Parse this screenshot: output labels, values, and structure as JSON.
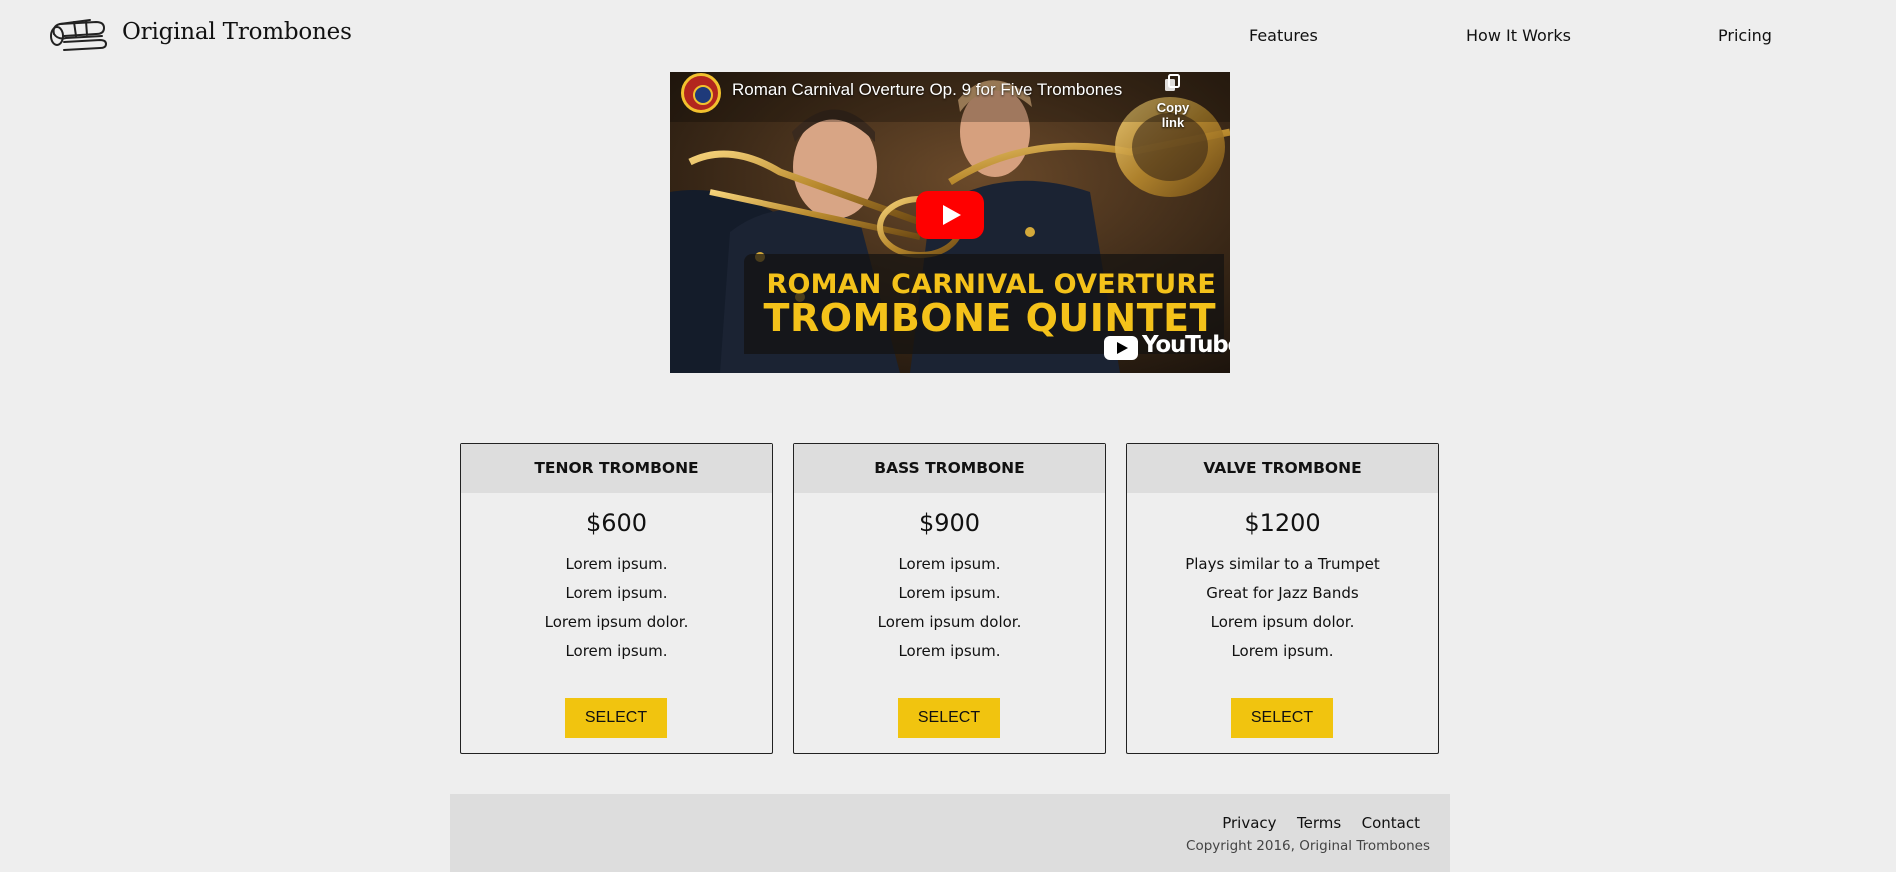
{
  "header": {
    "logo_icon": "trombone-icon",
    "brand": "Original Trombones",
    "nav": [
      {
        "label": "Features"
      },
      {
        "label": "How It Works"
      },
      {
        "label": "Pricing"
      }
    ]
  },
  "video": {
    "title": "Roman Carnival Overture Op. 9 for Five Trombones",
    "copy_link_label": "Copy link",
    "copy_link_icon": "copy-icon",
    "play_icon": "play-icon",
    "banner_line1": "ROMAN CARNIVAL OVERTURE",
    "banner_line2": "TROMBONE QUINTET",
    "watermark": "YouTube"
  },
  "pricing": {
    "plans": [
      {
        "name": "TENOR TROMBONE",
        "price": "$600",
        "features": [
          "Lorem ipsum.",
          "Lorem ipsum.",
          "Lorem ipsum dolor.",
          "Lorem ipsum."
        ],
        "button": "SELECT"
      },
      {
        "name": "BASS TROMBONE",
        "price": "$900",
        "features": [
          "Lorem ipsum.",
          "Lorem ipsum.",
          "Lorem ipsum dolor.",
          "Lorem ipsum."
        ],
        "button": "SELECT"
      },
      {
        "name": "VALVE TROMBONE",
        "price": "$1200",
        "features": [
          "Plays similar to a Trumpet",
          "Great for Jazz Bands",
          "Lorem ipsum dolor.",
          "Lorem ipsum."
        ],
        "button": "SELECT"
      }
    ]
  },
  "footer": {
    "links": [
      {
        "label": "Privacy"
      },
      {
        "label": "Terms"
      },
      {
        "label": "Contact"
      }
    ],
    "copyright": "Copyright 2016, Original Trombones"
  },
  "colors": {
    "background": "#eeeeee",
    "accent": "#f1c40f",
    "card_header": "#dddddd",
    "footer_bg": "#dddddd",
    "youtube_red": "#ff0000"
  }
}
